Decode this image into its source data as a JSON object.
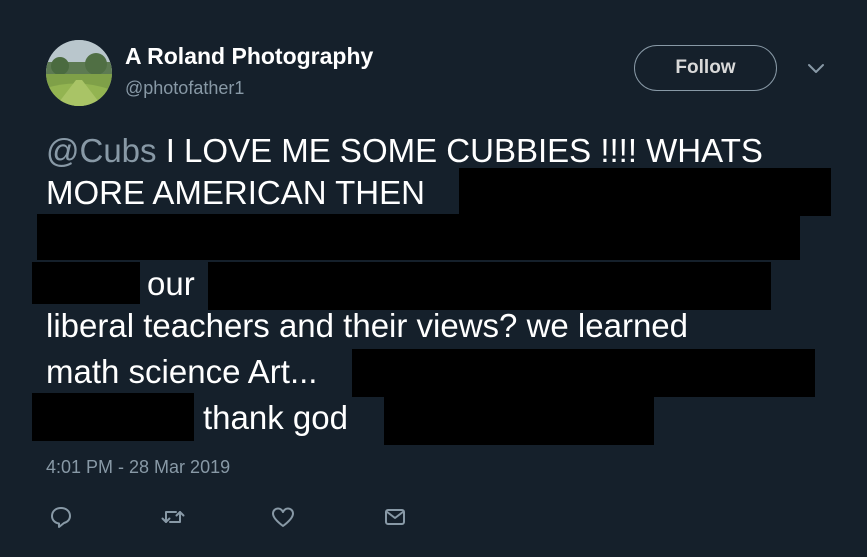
{
  "tweet": {
    "display_name": "A Roland Photography",
    "handle": "@photofather1",
    "follow_label": "Follow",
    "mention": "@Cubs",
    "line1_rest": " I LOVE ME SOME CUBBIES !!!! WHATS",
    "line2": "MORE AMERICAN THEN",
    "line4": "our",
    "line5": "liberal teachers and their views? we learned",
    "line6": "math science Art...",
    "line7": "thank god",
    "timestamp": "4:01 PM - 28 Mar 2019"
  },
  "icons": {
    "menu": "chevron-down-icon",
    "reply": "reply-icon",
    "retweet": "retweet-icon",
    "like": "heart-icon",
    "message": "envelope-icon"
  },
  "colors": {
    "background": "#15202b",
    "secondary_text": "#8899a6",
    "primary_text": "#ffffff",
    "redaction": "#000000"
  }
}
